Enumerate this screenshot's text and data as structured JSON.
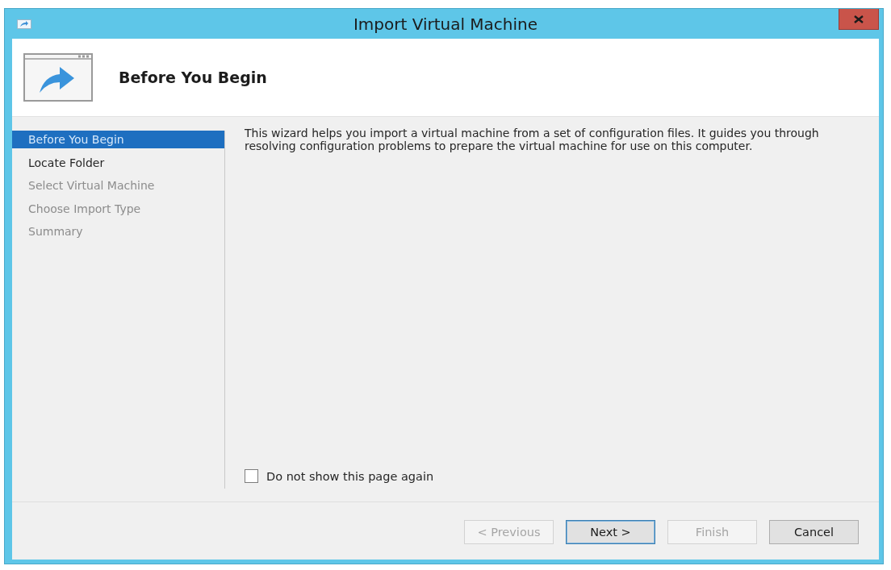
{
  "window": {
    "title": "Import Virtual Machine"
  },
  "header": {
    "title": "Before You Begin"
  },
  "steps": [
    {
      "label": "Before You Begin",
      "selected": true,
      "disabled": false
    },
    {
      "label": "Locate Folder",
      "selected": false,
      "disabled": false
    },
    {
      "label": "Select Virtual Machine",
      "selected": false,
      "disabled": true
    },
    {
      "label": "Choose Import Type",
      "selected": false,
      "disabled": true
    },
    {
      "label": "Summary",
      "selected": false,
      "disabled": true
    }
  ],
  "description": "This wizard helps you import a virtual machine from a set of configuration files. It guides you through resolving configuration problems to prepare the virtual machine for use on this computer.",
  "checkbox": {
    "label": "Do not show this page again",
    "checked": false
  },
  "buttons": [
    {
      "label": "< Previous",
      "disabled": true,
      "default": false
    },
    {
      "label": "Next >",
      "disabled": false,
      "default": true
    },
    {
      "label": "Finish",
      "disabled": true,
      "default": false
    },
    {
      "label": "Cancel",
      "disabled": false,
      "default": false
    }
  ]
}
